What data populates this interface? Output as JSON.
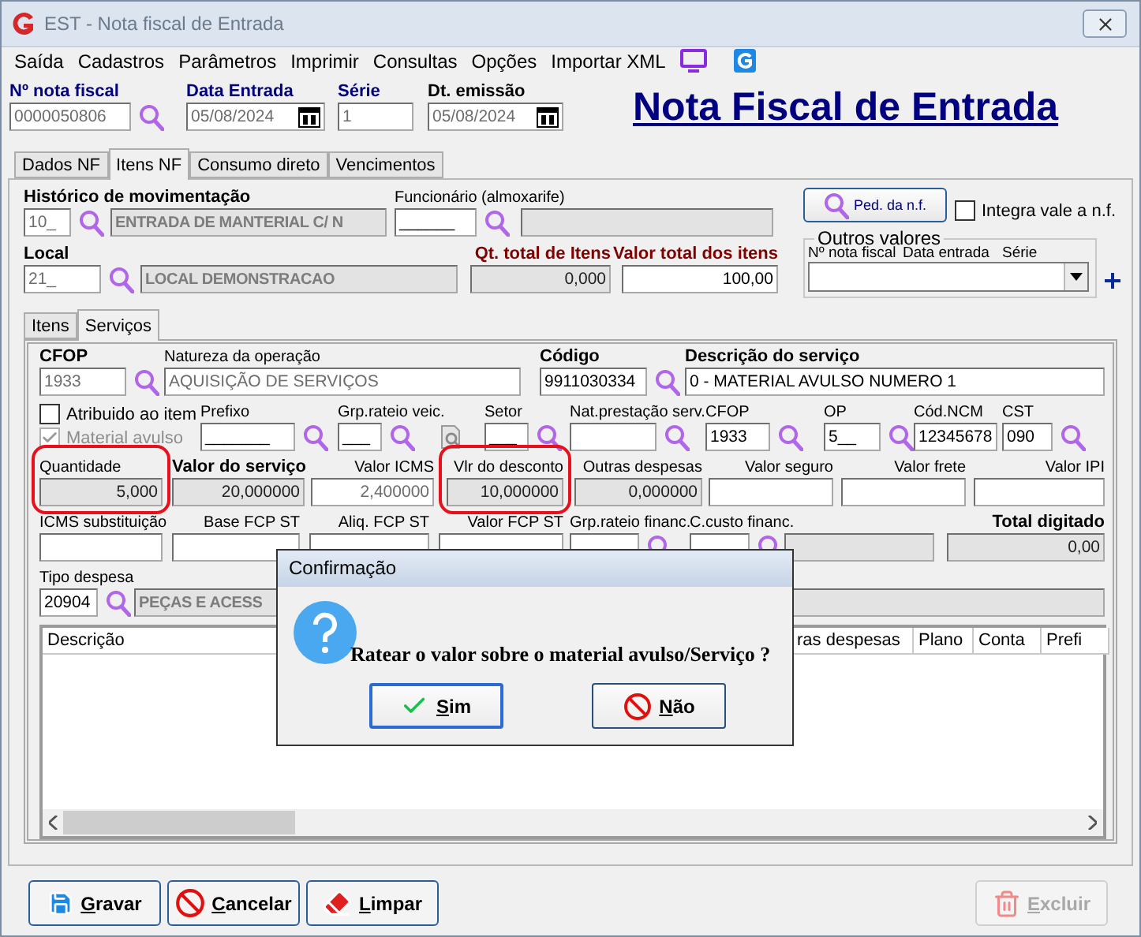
{
  "window": {
    "title": "EST - Nota fiscal de Entrada"
  },
  "menu": [
    "Saída",
    "Cadastros",
    "Parâmetros",
    "Imprimir",
    "Consultas",
    "Opções",
    "Importar XML"
  ],
  "header_fields": [
    {
      "label": {
        "text": "Nº nota fiscal",
        "kind": "primary"
      },
      "value": "0000050806",
      "kind": "inactive"
    },
    {
      "label": {
        "text": "Data Entrada",
        "kind": "primary"
      },
      "value": "05/08/2024",
      "kind": "date"
    },
    {
      "label": {
        "text": "Série",
        "kind": "primary"
      },
      "value": "1",
      "kind": "inactive"
    },
    {
      "label": {
        "text": "Dt. emissão",
        "kind": "strong"
      },
      "value": "05/08/2024",
      "kind": "date"
    }
  ],
  "page_title": "Nota Fiscal de Entrada",
  "tabs": [
    {
      "label": "Dados NF",
      "selected": false
    },
    {
      "label": "Itens NF",
      "selected": true
    },
    {
      "label": "Consumo direto",
      "selected": false
    },
    {
      "label": "Vencimentos",
      "selected": false
    }
  ],
  "movement_rows": [
    [
      {
        "label": {
          "text": "Histórico de movimentação",
          "kind": "strong"
        },
        "value": "10_",
        "kind": "inactive"
      },
      {
        "value": "ENTRADA DE MANTERIAL C/ N",
        "kind": "readonly_caps"
      },
      {
        "label": {
          "text": "Funcionário (almoxarife)",
          "kind": "plain"
        },
        "value": "______",
        "kind": "edit"
      },
      {
        "kind": "readonly"
      }
    ],
    [
      {
        "label": {
          "text": "Local",
          "kind": "strong"
        },
        "value": "21_",
        "kind": "inactive"
      },
      {
        "value": "LOCAL DEMONSTRACAO",
        "kind": "readonly_caps"
      },
      {
        "label": {
          "text": "Qt. total de Itens",
          "kind": "alert"
        },
        "value": "0,000",
        "kind": "readonly"
      },
      {
        "label": {
          "text": "Valor total dos itens",
          "kind": "alert"
        },
        "value": "100,00",
        "kind": "edit"
      }
    ]
  ],
  "order_button": {
    "label": "Ped. da n.f."
  },
  "integra": {
    "label": "Integra vale a n.f.",
    "checked": false
  },
  "outros_valores": {
    "title": "Outros valores",
    "columns": [
      "Nº nota fiscal",
      "Data entrada",
      "Série"
    ]
  },
  "sub_tabs": [
    {
      "label": "Itens",
      "selected": false
    },
    {
      "label": "Serviços",
      "selected": true
    }
  ],
  "service_checks": [
    {
      "label": "Atribuido ao item",
      "checked": false,
      "disabled": false
    },
    {
      "label": "Material avulso",
      "checked": true,
      "disabled": true
    }
  ],
  "service_rows": [
    [
      {
        "label": {
          "text": "CFOP",
          "kind": "strong"
        },
        "value": "1933",
        "kind": "inactive"
      },
      {
        "label": {
          "text": "Natureza da operação",
          "kind": "plain"
        },
        "value": "AQUISIÇÃO DE SERVIÇOS",
        "kind": "inactive"
      },
      {
        "label": {
          "text": "Código",
          "kind": "strong"
        },
        "value": "9911030334",
        "kind": "edit"
      },
      {
        "label": {
          "text": "Descrição do serviço",
          "kind": "strong"
        },
        "value": "0 - MATERIAL AVULSO NUMERO 1",
        "kind": "edit"
      }
    ],
    [
      {
        "label": {
          "text": "Prefixo",
          "kind": "plain"
        },
        "value": "_______",
        "kind": "edit"
      },
      {
        "label": {
          "text": "Grp.rateio veic.",
          "kind": "plain"
        },
        "value": "___",
        "kind": "edit"
      },
      {
        "label": {
          "text": "Setor",
          "kind": "plain"
        },
        "value": "___",
        "kind": "edit"
      },
      {
        "label": {
          "text": "Nat.prestação serv.",
          "kind": "plain"
        },
        "kind": "edit"
      },
      {
        "label": {
          "text": "CFOP",
          "kind": "plain"
        },
        "value": "1933",
        "kind": "edit"
      },
      {
        "label": {
          "text": "OP",
          "kind": "plain"
        },
        "value": "5__",
        "kind": "edit"
      },
      {
        "label": {
          "text": "Cód.NCM",
          "kind": "plain"
        },
        "value": "12345678",
        "kind": "edit"
      },
      {
        "label": {
          "text": "CST",
          "kind": "plain"
        },
        "value": "090",
        "kind": "edit"
      }
    ],
    [
      {
        "label": {
          "text": "Quantidade",
          "kind": "plain"
        },
        "value": "5,000",
        "kind": "readonly",
        "highlighted": true
      },
      {
        "label": {
          "text": "Valor do serviço",
          "kind": "strong"
        },
        "value": "20,000000",
        "kind": "readonly",
        "highlighted": false
      },
      {
        "label": {
          "text": "Valor ICMS",
          "kind": "plain"
        },
        "value": "2,400000",
        "kind": "inactive",
        "highlighted": false
      },
      {
        "label": {
          "text": "Vlr do desconto",
          "kind": "plain"
        },
        "value": "10,000000",
        "kind": "readonly",
        "highlighted": true
      },
      {
        "label": {
          "text": "Outras despesas",
          "kind": "plain"
        },
        "value": "0,000000",
        "kind": "readonly",
        "highlighted": false
      },
      {
        "label": {
          "text": "Valor seguro",
          "kind": "plain"
        },
        "kind": "edit",
        "highlighted": false
      },
      {
        "label": {
          "text": "Valor frete",
          "kind": "plain"
        },
        "kind": "edit",
        "highlighted": false
      },
      {
        "label": {
          "text": "Valor IPI",
          "kind": "plain"
        },
        "kind": "edit",
        "highlighted": false
      }
    ],
    [
      {
        "label": {
          "text": "ICMS substituição",
          "kind": "plain"
        },
        "kind": "edit"
      },
      {
        "label": {
          "text": "Base FCP ST",
          "kind": "plain"
        },
        "kind": "edit"
      },
      {
        "label": {
          "text": "Aliq. FCP ST",
          "kind": "plain"
        },
        "kind": "edit"
      },
      {
        "label": {
          "text": "Valor FCP ST",
          "kind": "plain"
        },
        "kind": "edit"
      },
      {
        "label": {
          "text": "Grp.rateio financ.",
          "kind": "plain"
        },
        "kind": "edit"
      },
      {
        "label": {
          "text": "C.custo financ.",
          "kind": "plain"
        },
        "kind": "edit"
      },
      {
        "kind": "readonly"
      },
      {
        "label": {
          "text": "Total digitado",
          "kind": "strong"
        },
        "value": "0,00",
        "kind": "readonly"
      }
    ],
    [
      {
        "label": {
          "text": "Tipo despesa",
          "kind": "plain"
        },
        "value": "20904",
        "kind": "edit"
      },
      {
        "value": "PEÇAS E ACESS",
        "kind": "readonly_caps"
      }
    ]
  ],
  "table": {
    "columns": [
      "Descrição",
      "ras despesas",
      "Plano",
      "Conta",
      "Prefi"
    ]
  },
  "dialog": {
    "title": "Confirmação",
    "message": "Ratear o valor sobre o material avulso/Serviço ?",
    "buttons": [
      {
        "label": "Sim",
        "kind": "confirm",
        "focused": true
      },
      {
        "label": "Não",
        "kind": "reject",
        "focused": false
      }
    ]
  },
  "footer_buttons": [
    {
      "label": "Gravar",
      "kind": "save",
      "disabled": false
    },
    {
      "label": "Cancelar",
      "kind": "cancel",
      "disabled": false
    },
    {
      "label": "Limpar",
      "kind": "clear",
      "disabled": false
    },
    {
      "label": "Excluir",
      "kind": "delete",
      "disabled": true
    }
  ]
}
